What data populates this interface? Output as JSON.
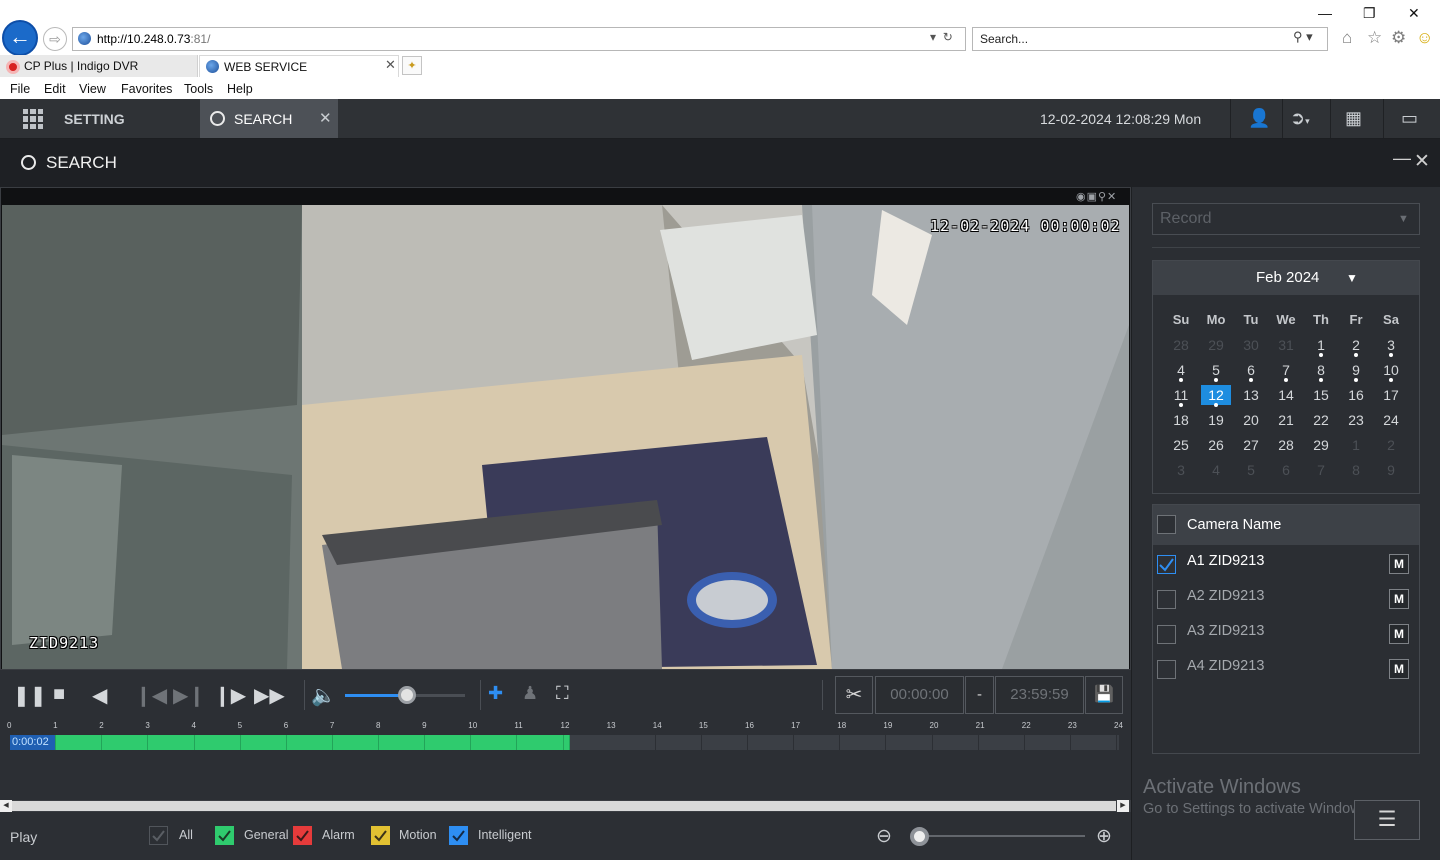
{
  "browser": {
    "url_host": "http://10.248.0.73",
    "url_rest": ":81/",
    "search_placeholder": "Search...",
    "tabs": [
      {
        "label": "CP Plus | Indigo DVR"
      },
      {
        "label": "WEB SERVICE"
      }
    ],
    "menu": [
      "File",
      "Edit",
      "View",
      "Favorites",
      "Tools",
      "Help"
    ]
  },
  "topbar": {
    "setting_label": "SETTING",
    "search_tab_label": "SEARCH",
    "datetime": "12-02-2024 12:08:29 Mon"
  },
  "search_header": {
    "title": "SEARCH"
  },
  "video": {
    "osd_time": "12-02-2024 00:00:02",
    "osd_name": "ZID9213"
  },
  "controls": {
    "volume_level": 0.52,
    "clip_start": "00:00:00",
    "clip_separator": "-",
    "clip_end": "23:59:59"
  },
  "timeline": {
    "ticks": [
      "0",
      "1",
      "2",
      "3",
      "4",
      "5",
      "6",
      "7",
      "8",
      "9",
      "10",
      "11",
      "12",
      "13",
      "14",
      "15",
      "16",
      "17",
      "18",
      "19",
      "20",
      "21",
      "22",
      "23",
      "24"
    ],
    "recorded_until_hour": 12.15,
    "cursor_label": "0:00:02"
  },
  "bottom": {
    "play_label": "Play",
    "legend": [
      {
        "label": "All",
        "color": "#2c2f34"
      },
      {
        "label": "General",
        "color": "#2fcb6e"
      },
      {
        "label": "Alarm",
        "color": "#e63b3b"
      },
      {
        "label": "Motion",
        "color": "#e2c132"
      },
      {
        "label": "Intelligent",
        "color": "#2e8ef2"
      }
    ]
  },
  "right_panel": {
    "record_type": "Record",
    "calendar": {
      "title": "Feb 2024",
      "dow": [
        "Su",
        "Mo",
        "Tu",
        "We",
        "Th",
        "Fr",
        "Sa"
      ],
      "weeks": [
        [
          "28",
          "29",
          "30",
          "31",
          "1",
          "2",
          "3"
        ],
        [
          "4",
          "5",
          "6",
          "7",
          "8",
          "9",
          "10"
        ],
        [
          "11",
          "12",
          "13",
          "14",
          "15",
          "16",
          "17"
        ],
        [
          "18",
          "19",
          "20",
          "21",
          "22",
          "23",
          "24"
        ],
        [
          "25",
          "26",
          "27",
          "28",
          "29",
          "1",
          "2"
        ],
        [
          "3",
          "4",
          "5",
          "6",
          "7",
          "8",
          "9"
        ]
      ],
      "selected_day": "12"
    },
    "camera_header": "Camera Name",
    "cameras": [
      {
        "name": "A1 ZID9213",
        "checked": true,
        "m": "M"
      },
      {
        "name": "A2 ZID9213",
        "checked": false,
        "m": "M"
      },
      {
        "name": "A3 ZID9213",
        "checked": false,
        "m": "M"
      },
      {
        "name": "A4 ZID9213",
        "checked": false,
        "m": "M"
      }
    ],
    "watermark_title": "Activate Windows",
    "watermark_sub": "Go to Settings to activate Windows."
  }
}
